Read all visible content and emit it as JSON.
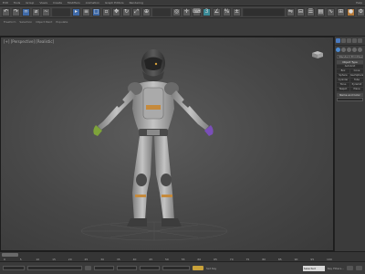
{
  "titlebar": {
    "left_items": [
      "Edit",
      "Tools",
      "Group",
      "Views",
      "Create",
      "Modifiers",
      "Animation",
      "Graph Editors",
      "Rendering"
    ],
    "right_items": [
      "Help"
    ]
  },
  "toolbar": {
    "selection_set_value": ""
  },
  "ribbon": {
    "tabs": [
      "Freeform",
      "Selection",
      "Object Paint",
      "Populate"
    ]
  },
  "viewport": {
    "label": "[+] [Perspective] [Realistic]"
  },
  "command_panel": {
    "dropdown_value": "Standard Primitives",
    "rollout_object_type": "Object Type",
    "autogrid_label": "AutoGrid",
    "buttons": [
      "Box",
      "Cone",
      "Sphere",
      "GeoSphere",
      "Cylinder",
      "Tube",
      "Torus",
      "Pyramid",
      "Teapot",
      "Plane"
    ],
    "rollout_name_color": "Name and Color"
  },
  "timeline": {
    "slider_text": "0 / 100",
    "ticks": [
      0,
      5,
      10,
      15,
      20,
      25,
      30,
      35,
      40,
      45,
      50,
      55,
      60,
      65,
      70,
      75,
      80,
      85,
      90,
      95,
      100
    ]
  },
  "statusbar": {
    "auto_key_label": "Auto Key",
    "set_key_label": "Set Key",
    "selected_value": "Selected",
    "key_filters_label": "Key Filters..."
  },
  "colors": {
    "viewport_bg": "#474747",
    "accent_blue": "#3f6aa8",
    "auto_key": "#c9a23a"
  }
}
